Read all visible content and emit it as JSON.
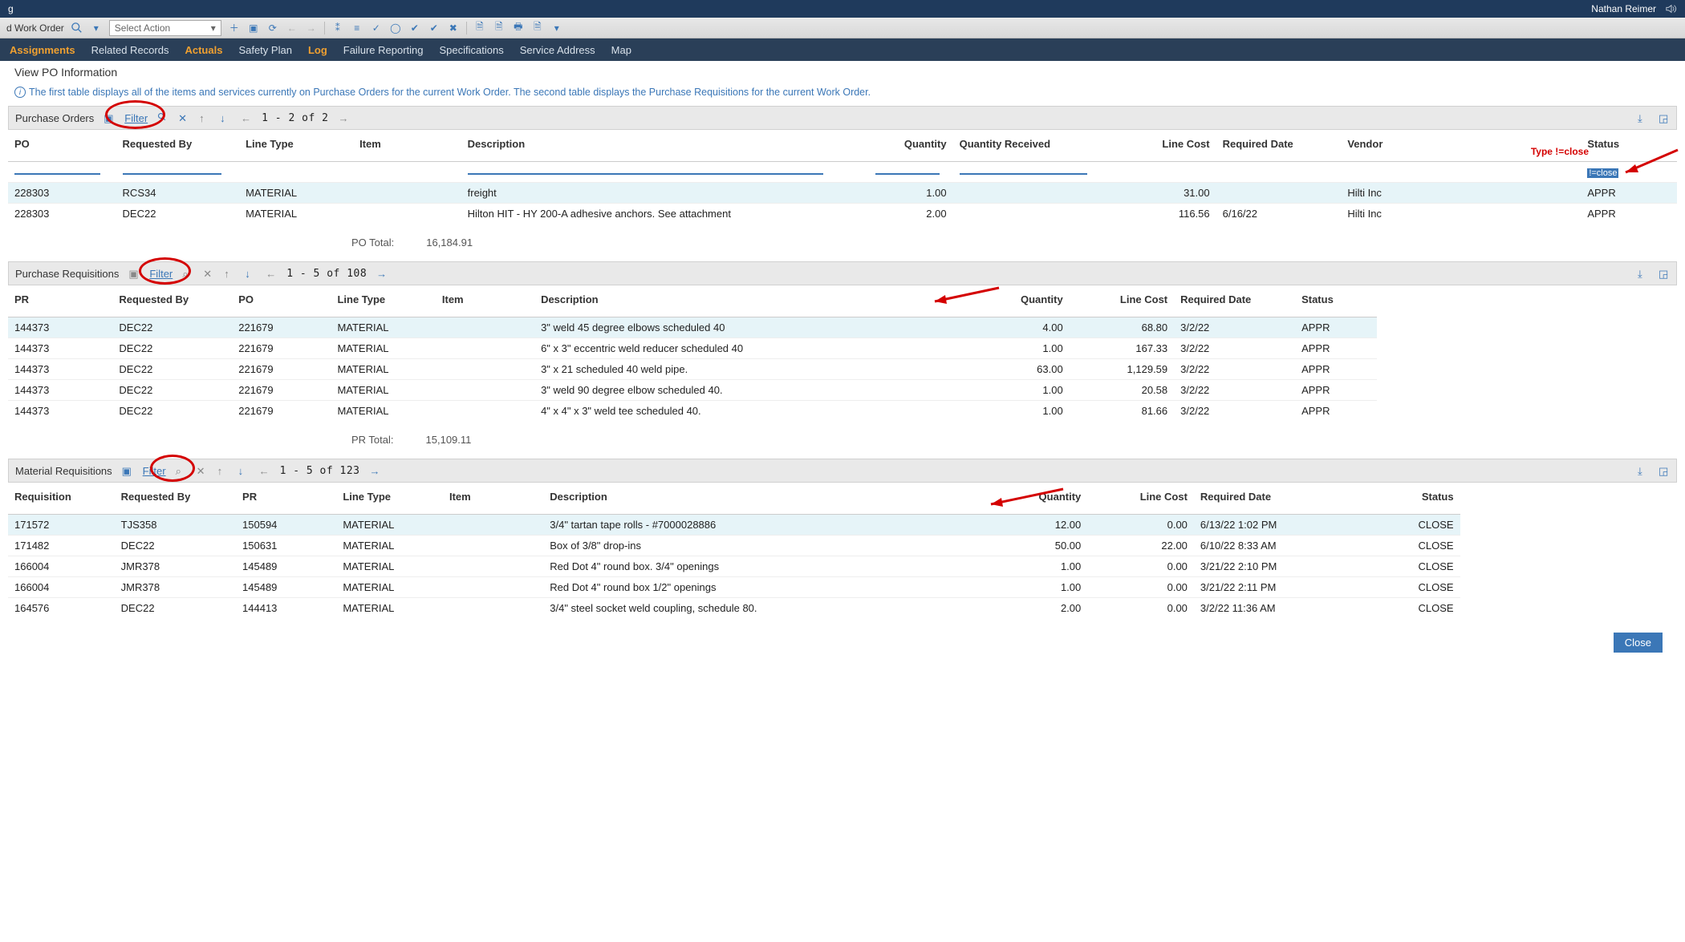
{
  "topbar": {
    "left": "g",
    "user": "Nathan Reimer",
    "sound_icon": "sound-icon"
  },
  "secondbar": {
    "breadcrumb": "d Work Order",
    "select_action": "Select Action"
  },
  "tabs": [
    {
      "label": "Assignments",
      "active": true
    },
    {
      "label": "Related Records",
      "active": false
    },
    {
      "label": "Actuals",
      "active": true
    },
    {
      "label": "Safety Plan",
      "active": false
    },
    {
      "label": "Log",
      "active": true
    },
    {
      "label": "Failure Reporting",
      "active": false
    },
    {
      "label": "Specifications",
      "active": false
    },
    {
      "label": "Service Address",
      "active": false
    },
    {
      "label": "Map",
      "active": false
    }
  ],
  "dialog_title": "View PO Information",
  "info_text": "The first table displays all of the items and services currently on Purchase Orders for the current Work Order. The second table displays the Purchase Requisitions for the current Work Order.",
  "annotations": {
    "type_label": "Type !=close",
    "filter_value": "!=close"
  },
  "po_section": {
    "name": "Purchase Orders",
    "filter": "Filter",
    "paging": "1 - 2 of 2",
    "headers": [
      "PO",
      "Requested By",
      "Line Type",
      "Item",
      "Description",
      "Quantity",
      "Quantity Received",
      "Line Cost",
      "Required Date",
      "Vendor",
      "Status"
    ],
    "rows": [
      {
        "po": "228303",
        "req": "RCS34",
        "lt": "MATERIAL",
        "item": "",
        "desc": "freight",
        "qty": "1.00",
        "qr": "",
        "lc": "31.00",
        "rd": "",
        "vendor": "Hilti Inc",
        "status": "APPR"
      },
      {
        "po": "228303",
        "req": "DEC22",
        "lt": "MATERIAL",
        "item": "",
        "desc": "Hilton HIT - HY 200-A adhesive anchors. See attachment",
        "qty": "2.00",
        "qr": "",
        "lc": "116.56",
        "rd": "6/16/22",
        "vendor": "Hilti Inc",
        "status": "APPR"
      }
    ],
    "total_label": "PO Total:",
    "total_value": "16,184.91"
  },
  "pr_section": {
    "name": "Purchase Requisitions",
    "filter": "Filter",
    "paging": "1 -   5 of 108",
    "headers": [
      "PR",
      "Requested By",
      "PO",
      "Line Type",
      "Item",
      "Description",
      "Quantity",
      "Line Cost",
      "Required Date",
      "Status"
    ],
    "rows": [
      {
        "pr": "144373",
        "req": "DEC22",
        "po": "221679",
        "lt": "MATERIAL",
        "item": "",
        "desc": "3\" weld 45 degree elbows scheduled 40",
        "qty": "4.00",
        "lc": "68.80",
        "rd": "3/2/22",
        "status": "APPR"
      },
      {
        "pr": "144373",
        "req": "DEC22",
        "po": "221679",
        "lt": "MATERIAL",
        "item": "",
        "desc": "6\" x 3\" eccentric weld reducer scheduled 40",
        "qty": "1.00",
        "lc": "167.33",
        "rd": "3/2/22",
        "status": "APPR"
      },
      {
        "pr": "144373",
        "req": "DEC22",
        "po": "221679",
        "lt": "MATERIAL",
        "item": "",
        "desc": "3\" x 21 scheduled 40 weld pipe.",
        "qty": "63.00",
        "lc": "1,129.59",
        "rd": "3/2/22",
        "status": "APPR"
      },
      {
        "pr": "144373",
        "req": "DEC22",
        "po": "221679",
        "lt": "MATERIAL",
        "item": "",
        "desc": "3\" weld 90 degree elbow scheduled 40.",
        "qty": "1.00",
        "lc": "20.58",
        "rd": "3/2/22",
        "status": "APPR"
      },
      {
        "pr": "144373",
        "req": "DEC22",
        "po": "221679",
        "lt": "MATERIAL",
        "item": "",
        "desc": "4\" x 4\" x 3\" weld tee scheduled 40.",
        "qty": "1.00",
        "lc": "81.66",
        "rd": "3/2/22",
        "status": "APPR"
      }
    ],
    "total_label": "PR Total:",
    "total_value": "15,109.11"
  },
  "mr_section": {
    "name": "Material Requisitions",
    "filter": "Filter",
    "paging": "1 -   5 of 123",
    "headers": [
      "Requisition",
      "Requested By",
      "PR",
      "Line Type",
      "Item",
      "Description",
      "Quantity",
      "Line Cost",
      "Required Date",
      "Status"
    ],
    "rows": [
      {
        "r": "171572",
        "req": "TJS358",
        "pr": "150594",
        "lt": "MATERIAL",
        "item": "",
        "desc": "3/4\" tartan tape rolls - #7000028886",
        "qty": "12.00",
        "lc": "0.00",
        "rd": "6/13/22 1:02 PM",
        "status": "CLOSE"
      },
      {
        "r": "171482",
        "req": "DEC22",
        "pr": "150631",
        "lt": "MATERIAL",
        "item": "",
        "desc": "Box of 3/8\" drop-ins",
        "qty": "50.00",
        "lc": "22.00",
        "rd": "6/10/22 8:33 AM",
        "status": "CLOSE"
      },
      {
        "r": "166004",
        "req": "JMR378",
        "pr": "145489",
        "lt": "MATERIAL",
        "item": "",
        "desc": "Red Dot 4\" round box. 3/4\" openings",
        "qty": "1.00",
        "lc": "0.00",
        "rd": "3/21/22 2:10 PM",
        "status": "CLOSE"
      },
      {
        "r": "166004",
        "req": "JMR378",
        "pr": "145489",
        "lt": "MATERIAL",
        "item": "",
        "desc": "Red Dot 4\" round box 1/2\" openings",
        "qty": "1.00",
        "lc": "0.00",
        "rd": "3/21/22 2:11 PM",
        "status": "CLOSE"
      },
      {
        "r": "164576",
        "req": "DEC22",
        "pr": "144413",
        "lt": "MATERIAL",
        "item": "",
        "desc": "3/4\" steel socket weld coupling, schedule 80.",
        "qty": "2.00",
        "lc": "0.00",
        "rd": "3/2/22 11:36 AM",
        "status": "CLOSE"
      }
    ]
  },
  "close_button": "Close"
}
